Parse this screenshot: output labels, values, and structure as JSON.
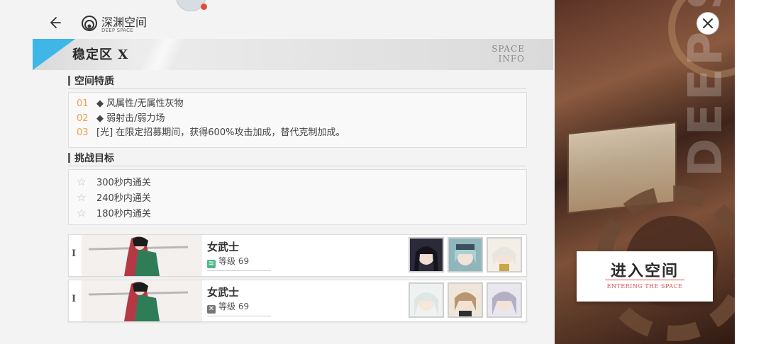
{
  "header": {
    "title": "深渊空间",
    "subtitle": "DEEP SPACE"
  },
  "zone": {
    "name": "稳定区 X",
    "info_line1": "SPACE",
    "info_line2": "INFO"
  },
  "traits": {
    "heading": "空间特质",
    "items": [
      {
        "num": "01",
        "text": "◆ 风属性/无属性灰物"
      },
      {
        "num": "02",
        "text": "◆ 弱射击/弱力场"
      },
      {
        "num": "03",
        "text": "[光] 在限定招募期间，获得600%攻击加成，替代克制加成。"
      }
    ]
  },
  "goals": {
    "heading": "挑战目标",
    "items": [
      {
        "star": "☆",
        "text": "300秒内通关"
      },
      {
        "star": "☆",
        "text": "240秒内通关"
      },
      {
        "star": "☆",
        "text": "180秒内通关"
      }
    ]
  },
  "enemies": [
    {
      "roman": "I",
      "name": "女武士",
      "level_label": "等级",
      "level": "69",
      "element": "wind",
      "element_color": "#4fb98a"
    },
    {
      "roman": "I",
      "name": "女武士",
      "level_label": "等级",
      "level": "69",
      "element": "none",
      "element_color": "#777777"
    }
  ],
  "enter": {
    "label": "进入空间",
    "sub": "ENTERING THE SPACE"
  },
  "side": {
    "bg_text": "DEEP SPACE"
  },
  "colors": {
    "accent_blue": "#3eb6e8",
    "number_orange": "#f0a04a",
    "enter_red": "#d8534f"
  }
}
